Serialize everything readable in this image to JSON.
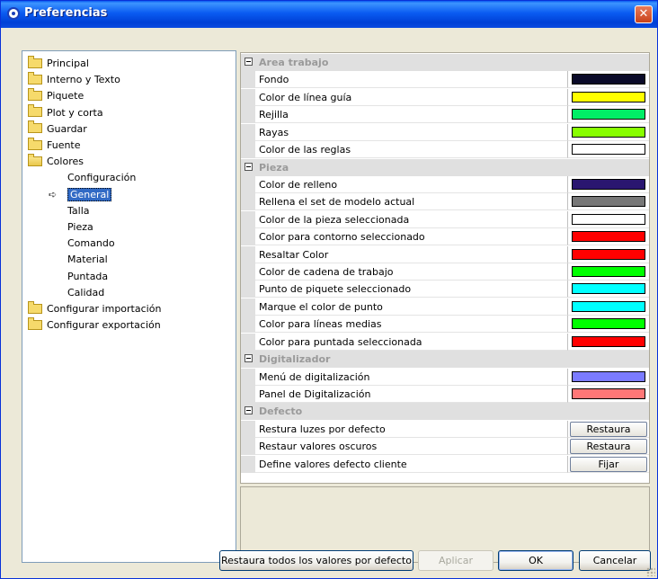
{
  "window": {
    "title": "Preferencias",
    "close_glyph": "✕"
  },
  "tree": [
    {
      "label": "Principal",
      "type": "folder",
      "name": "principal"
    },
    {
      "label": "Interno y Texto",
      "type": "folder",
      "name": "interno-y-texto"
    },
    {
      "label": "Piquete",
      "type": "folder",
      "name": "piquete"
    },
    {
      "label": "Plot y corta",
      "type": "folder",
      "name": "plot-y-corta"
    },
    {
      "label": "Guardar",
      "type": "folder",
      "name": "guardar"
    },
    {
      "label": "Fuente",
      "type": "folder",
      "name": "fuente"
    },
    {
      "label": "Colores",
      "type": "folder-open",
      "name": "colores"
    },
    {
      "label": "Configuración",
      "type": "child",
      "name": "configuracion"
    },
    {
      "label": "General",
      "type": "child",
      "name": "general",
      "selected": true
    },
    {
      "label": "Talla",
      "type": "child",
      "name": "talla"
    },
    {
      "label": "Pieza",
      "type": "child",
      "name": "pieza"
    },
    {
      "label": "Comando",
      "type": "child",
      "name": "comando"
    },
    {
      "label": "Material",
      "type": "child",
      "name": "material"
    },
    {
      "label": "Puntada",
      "type": "child",
      "name": "puntada"
    },
    {
      "label": "Calidad",
      "type": "child",
      "name": "calidad"
    },
    {
      "label": "Configurar importación",
      "type": "folder",
      "name": "configurar-importacion"
    },
    {
      "label": "Configurar exportación",
      "type": "folder",
      "name": "configurar-exportacion"
    }
  ],
  "property_rows": [
    {
      "kind": "group",
      "label": "Area trabajo"
    },
    {
      "kind": "color",
      "label": "Fondo",
      "color": "#0a0a28"
    },
    {
      "kind": "color",
      "label": "Color de línea guía",
      "color": "#ffff00"
    },
    {
      "kind": "color",
      "label": "Rejilla",
      "color": "#00ee66"
    },
    {
      "kind": "color",
      "label": "Rayas",
      "color": "#88ff00"
    },
    {
      "kind": "color",
      "label": "Color de las reglas",
      "color": "#ffffff"
    },
    {
      "kind": "group",
      "label": "Pieza"
    },
    {
      "kind": "color",
      "label": "Color de relleno",
      "color": "#2a1670"
    },
    {
      "kind": "color",
      "label": "Rellena el set de modelo actual",
      "color": "#777777"
    },
    {
      "kind": "color",
      "label": "Color de la pieza seleccionada",
      "color": "#ffffff"
    },
    {
      "kind": "color",
      "label": "Color para contorno seleccionado",
      "color": "#ff0000"
    },
    {
      "kind": "color",
      "label": "Resaltar Color",
      "color": "#ff0000"
    },
    {
      "kind": "color",
      "label": "Color de cadena de trabajo",
      "color": "#00ff00"
    },
    {
      "kind": "color",
      "label": "Punto de piquete seleccionado",
      "color": "#00ffff"
    },
    {
      "kind": "color",
      "label": "Marque el color de punto",
      "color": "#00ffff"
    },
    {
      "kind": "color",
      "label": "Color para líneas medias",
      "color": "#00ff00"
    },
    {
      "kind": "color",
      "label": "Color para puntada seleccionada",
      "color": "#ff0000"
    },
    {
      "kind": "group",
      "label": "Digitalizador"
    },
    {
      "kind": "color",
      "label": "Menú de digitalización",
      "color": "#7b7bff"
    },
    {
      "kind": "color",
      "label": "Panel de Digitalización",
      "color": "#ff7777"
    },
    {
      "kind": "group",
      "label": "Defecto"
    },
    {
      "kind": "button",
      "label": "Restura luzes por defecto",
      "button": "Restaura"
    },
    {
      "kind": "button",
      "label": "Restaur valores oscuros",
      "button": "Restaura"
    },
    {
      "kind": "button",
      "label": "Define valores defecto cliente",
      "button": "Fijar"
    }
  ],
  "footer": {
    "restore_all": "Restaura todos los valores por defecto",
    "apply": "Aplicar",
    "ok": "OK",
    "cancel": "Cancelar"
  }
}
